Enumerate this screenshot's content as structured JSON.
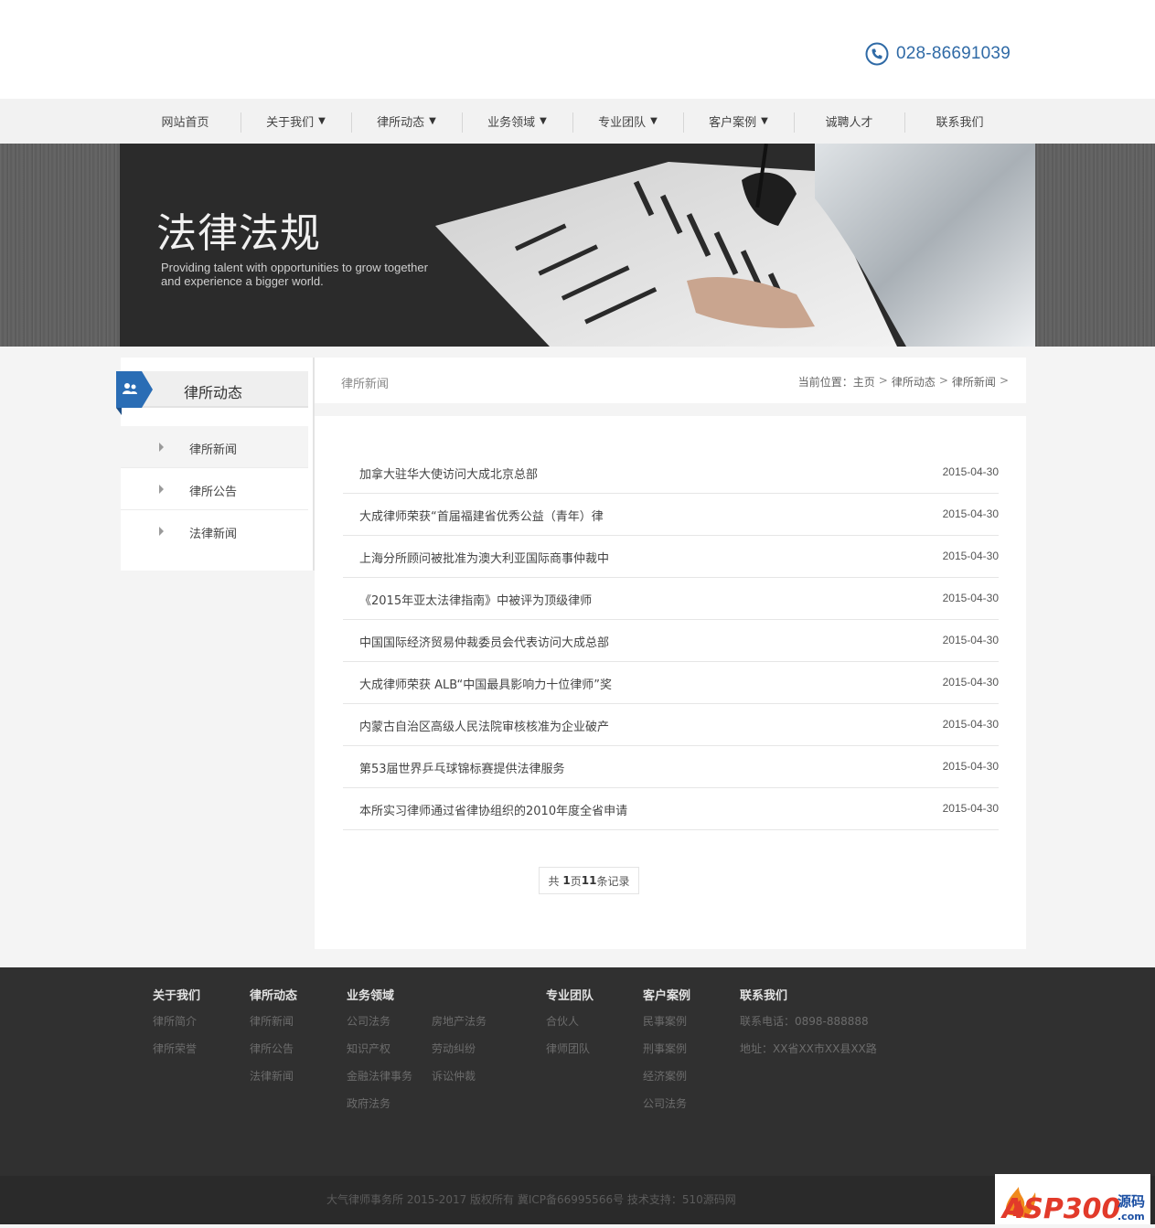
{
  "header": {
    "phone": "028-86691039",
    "phone_icon": "phone-icon"
  },
  "nav": {
    "items": [
      {
        "label": "网站首页",
        "dropdown": false
      },
      {
        "label": "关于我们",
        "dropdown": true
      },
      {
        "label": "律所动态",
        "dropdown": true
      },
      {
        "label": "业务领域",
        "dropdown": true
      },
      {
        "label": "专业团队",
        "dropdown": true
      },
      {
        "label": "客户案例",
        "dropdown": true
      },
      {
        "label": "诚聘人才",
        "dropdown": false
      },
      {
        "label": "联系我们",
        "dropdown": false
      }
    ],
    "caret": "▼"
  },
  "banner": {
    "title": "法律法规",
    "subtitle_line1": "Providing talent with opportunities to grow together",
    "subtitle_line2": "and experience a bigger world."
  },
  "sidebar": {
    "title": "律所动态",
    "icon": "users-icon",
    "accent_color": "#2a6db5",
    "items": [
      {
        "label": "律所新闻",
        "active": true
      },
      {
        "label": "律所公告",
        "active": false
      },
      {
        "label": "法律新闻",
        "active": false
      }
    ]
  },
  "titlebar": {
    "section": "律所新闻",
    "breadcrumb_prefix": "当前位置：",
    "breadcrumb": [
      "主页",
      "律所动态",
      "律所新闻"
    ],
    "separator": ">"
  },
  "news": [
    {
      "title": "加拿大驻华大使访问大成北京总部",
      "date": "2015-04-30"
    },
    {
      "title": "大成律师荣获“首届福建省优秀公益（青年）律",
      "date": "2015-04-30"
    },
    {
      "title": "上海分所顾问被批准为澳大利亚国际商事仲裁中",
      "date": "2015-04-30"
    },
    {
      "title": "《2015年亚太法律指南》中被评为顶级律师",
      "date": "2015-04-30"
    },
    {
      "title": "中国国际经济贸易仲裁委员会代表访问大成总部",
      "date": "2015-04-30"
    },
    {
      "title": "大成律师荣获 ALB“中国最具影响力十位律师”奖",
      "date": "2015-04-30"
    },
    {
      "title": "内蒙古自治区高级人民法院审核核准为企业破产",
      "date": "2015-04-30"
    },
    {
      "title": "第53届世界乒乓球锦标赛提供法律服务",
      "date": "2015-04-30"
    },
    {
      "title": "本所实习律师通过省律协组织的2010年度全省申请",
      "date": "2015-04-30"
    }
  ],
  "pagination": {
    "prefix": "共 ",
    "pages": "1",
    "mid": "页",
    "records": "11",
    "suffix": "条记录"
  },
  "footer": {
    "columns": [
      {
        "heading": "关于我们",
        "links": [
          "律所简介",
          "律所荣誉"
        ]
      },
      {
        "heading": "律所动态",
        "links": [
          "律所新闻",
          "律所公告",
          "法律新闻"
        ]
      },
      {
        "heading": "业务领域",
        "links_a": [
          "公司法务",
          "知识产权",
          "金融法律事务",
          "政府法务"
        ],
        "links_b": [
          "房地产法务",
          "劳动纠纷",
          "诉讼仲裁"
        ]
      },
      {
        "heading": "专业团队",
        "links": [
          "合伙人",
          "律师团队"
        ]
      },
      {
        "heading": "客户案例",
        "links": [
          "民事案例",
          "刑事案例",
          "经济案例",
          "公司法务"
        ]
      },
      {
        "heading": "联系我们",
        "lines": [
          "联系电话：0898-888888",
          "地址：XX省XX市XX县XX路"
        ]
      }
    ],
    "copyright": "大气律师事务所 2015-2017 版权所有 冀ICP备66995566号 技术支持：510源码网",
    "watermark_logo": "ASP300源码 .com"
  }
}
